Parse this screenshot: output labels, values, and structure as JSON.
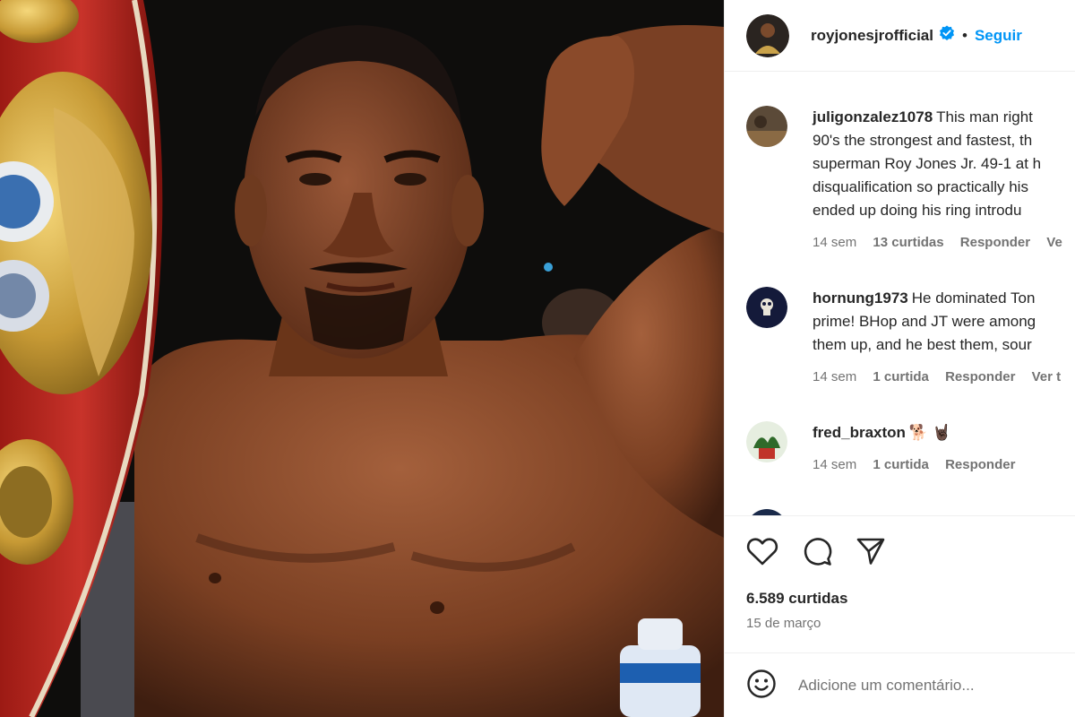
{
  "post": {
    "image_alt": "Boxer with championship belt flexing arm",
    "author": {
      "username": "royjonesjrofficial",
      "verified": true,
      "separator": "•",
      "follow_label": "Seguir"
    },
    "comments": [
      {
        "username": "juligonzalez1078",
        "lines": [
          "This man right",
          "90's the strongest and fastest, th",
          "superman Roy Jones Jr. 49-1 at h",
          "disqualification so practically his",
          "ended up doing his ring introdu"
        ],
        "time": "14 sem",
        "likes": "13 curtidas",
        "reply": "Responder",
        "translate": "Ve"
      },
      {
        "username": "hornung1973",
        "lines": [
          "He dominated Ton",
          "prime! BHop and JT were among",
          "them up, and he best them, sour"
        ],
        "time": "14 sem",
        "likes": "1 curtida",
        "reply": "Responder",
        "translate": "Ver t"
      },
      {
        "username": "fred_braxton",
        "lines": [
          "🐕 🤘🏿"
        ],
        "time": "14 sem",
        "likes": "1 curtida",
        "reply": "Responder",
        "translate": ""
      }
    ],
    "like_count": "6.589 curtidas",
    "date": "15 de março",
    "comment_placeholder": "Adicione um comentário..."
  },
  "icons": {
    "like": "heart-icon",
    "comment": "comment-bubble-icon",
    "share": "send-icon",
    "emoji": "smiley-icon",
    "verified": "verified-badge-icon"
  },
  "colors": {
    "link": "#0095f6",
    "muted": "#737373",
    "border": "#efefef",
    "verified": "#0095f6"
  }
}
